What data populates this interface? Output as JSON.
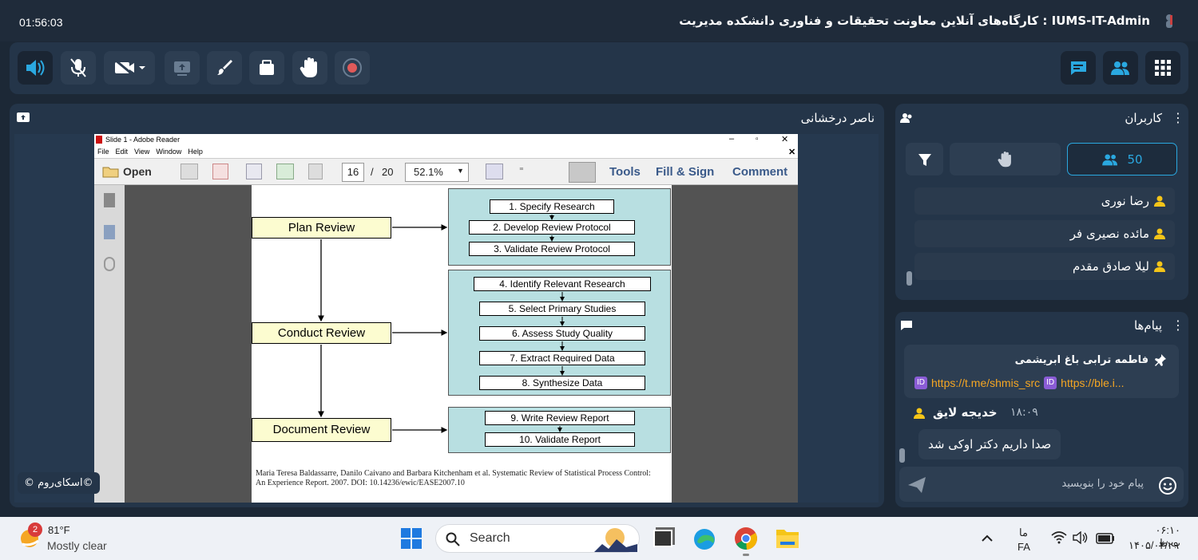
{
  "top": {
    "timer": "01:56:03",
    "title": "IUMS-IT-Admin : کارگاه‌های آنلاین معاونت تحقیقات و فناوری دانشکده مدیریت"
  },
  "colors": {
    "accent": "#2aa8e0",
    "panel": "#243549",
    "bg": "#1c2836"
  },
  "presenter": {
    "name": "ناصر درخشانی"
  },
  "watermark": "©اسکای‌روم ©",
  "adobe": {
    "window_title": "Slide 1 - Adobe Reader",
    "menu": [
      "File",
      "Edit",
      "View",
      "Window",
      "Help"
    ],
    "open_label": "Open",
    "page_current": "16",
    "page_sep": "/",
    "page_total": "20",
    "zoom": "52.1%",
    "tools": "Tools",
    "fill_sign": "Fill & Sign",
    "comment": "Comment"
  },
  "slide": {
    "plan": "Plan Review",
    "conduct": "Conduct Review",
    "document": "Document Review",
    "steps": [
      "1. Specify Research",
      "2. Develop Review Protocol",
      "3. Validate Review Protocol",
      "4. Identify Relevant Research",
      "5. Select Primary Studies",
      "6. Assess Study Quality",
      "7. Extract Required Data",
      "8. Synthesize Data",
      "9. Write Review Report",
      "10. Validate Report"
    ],
    "cite1": "Maria Teresa Baldassarre, Danilo Caivano and Barbara Kitchenham et al. Systematic Review of Statistical Process Control:",
    "cite2": "An Experience Report. 2007. DOI: 10.14236/ewic/EASE2007.10"
  },
  "users": {
    "title": "کاربران",
    "count": "50",
    "list": [
      "رضا نوری",
      "مائده نصیری فر",
      "لیلا صادق مقدم"
    ]
  },
  "messages": {
    "title": "پیام‌ها",
    "pinned_name": "فاطمه ترابی باغ ابریشمی",
    "pinned_link1": "https://t.me/shmis_src",
    "pinned_link2": "https://ble.i...",
    "sender": "خدیجه لایق",
    "time": "۱۸:۰۹",
    "text": "صدا داریم دکتر اوکی شد",
    "placeholder": "پیام خود را بنویسید"
  },
  "taskbar": {
    "badge": "2",
    "temp": "81°F",
    "weather": "Mostly clear",
    "search": "Search",
    "lang1": "ما",
    "lang2": "FA",
    "time": "۰۶:۱۰ ب.ظ",
    "date": "۱۴۰۵/۰۴/۲۹"
  }
}
